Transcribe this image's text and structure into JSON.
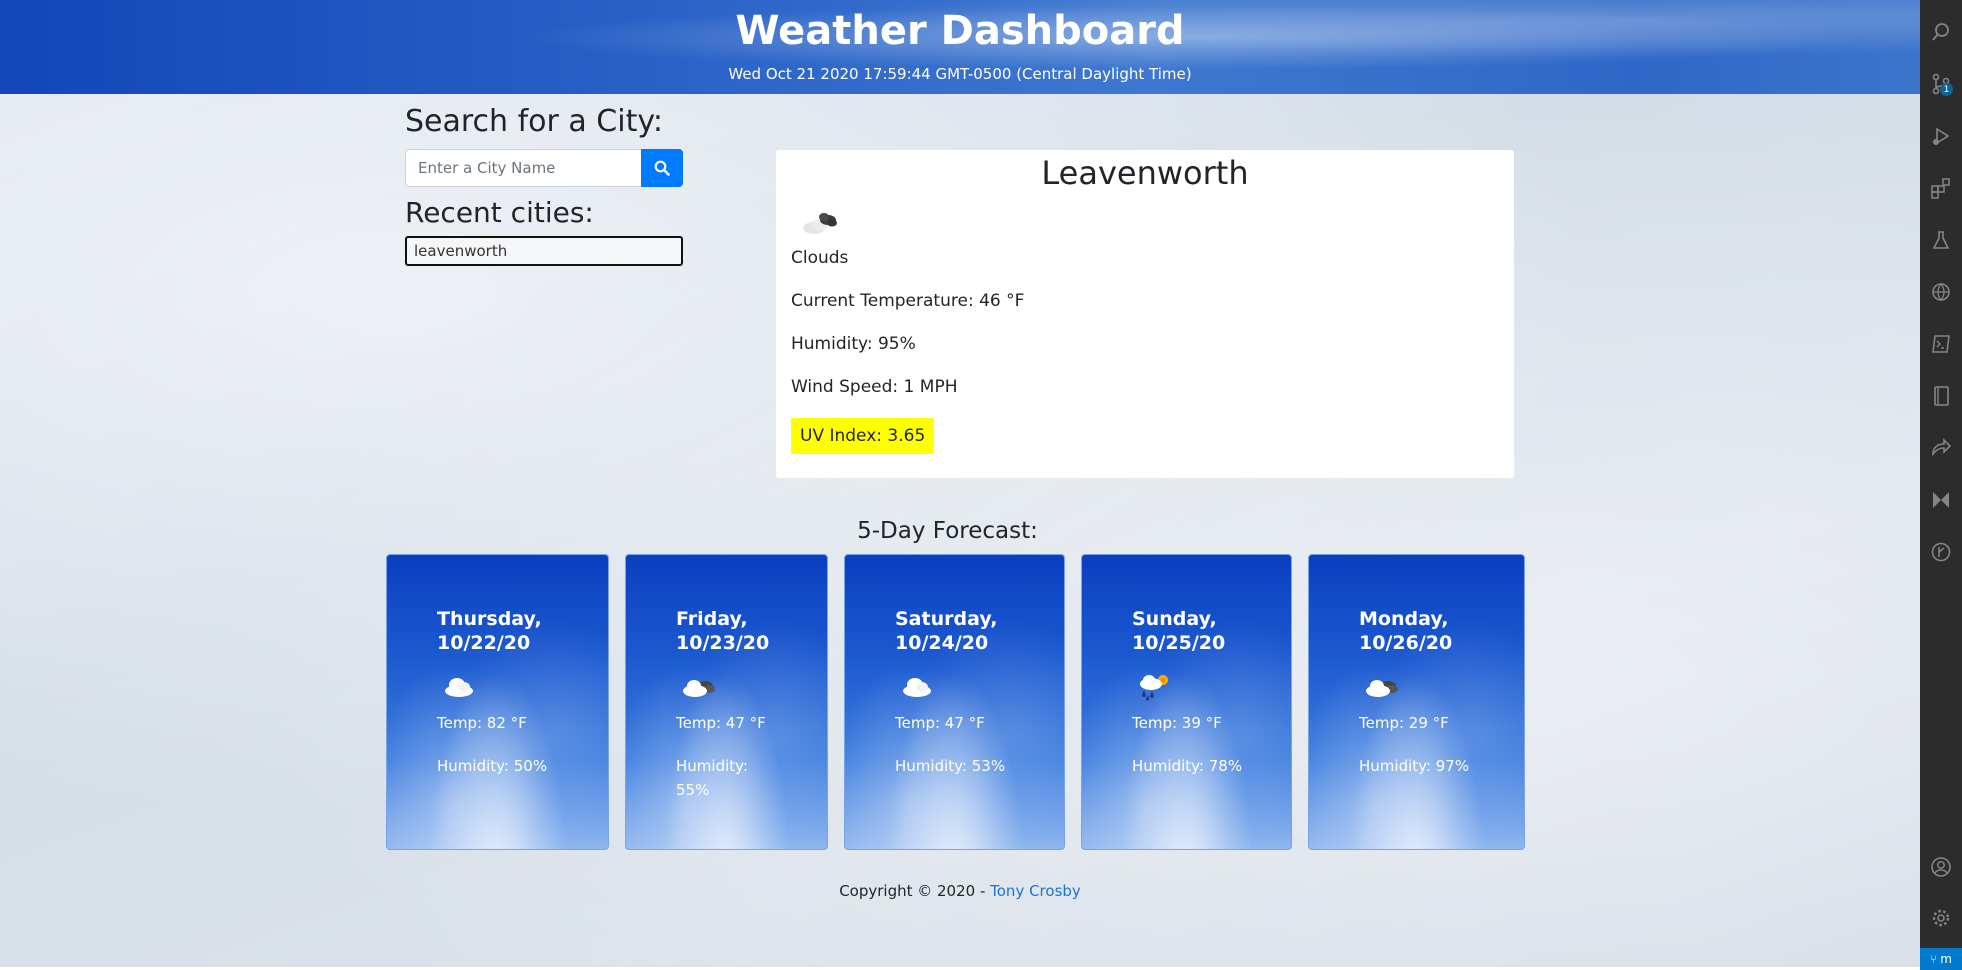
{
  "header": {
    "title": "Weather Dashboard",
    "datetime": "Wed Oct 21 2020 17:59:44 GMT-0500 (Central Daylight Time)"
  },
  "search": {
    "title": "Search for a City:",
    "placeholder": "Enter a City Name",
    "value": "",
    "button_icon": "search-icon"
  },
  "recent": {
    "title": "Recent cities:",
    "items": [
      "leavenworth"
    ]
  },
  "current": {
    "city": "Leavenworth",
    "icon": "clouds-icon",
    "condition": "Clouds",
    "temperature": "Current Temperature: 46 °F",
    "humidity": "Humidity: 95%",
    "wind": "Wind Speed: 1 MPH",
    "uv": "UV Index: 3.65",
    "uv_color": "#ffff00"
  },
  "forecast": {
    "title": "5-Day Forecast:",
    "days": [
      {
        "day": "Thursday,",
        "date": "10/22/20",
        "icon": "cloud-icon",
        "temp": "Temp: 82 °F",
        "humidity": "Humidity: 50%"
      },
      {
        "day": "Friday,",
        "date": "10/23/20",
        "icon": "broken-clouds-icon",
        "temp": "Temp: 47 °F",
        "humidity": "Humidity: 55%"
      },
      {
        "day": "Saturday,",
        "date": "10/24/20",
        "icon": "cloud-icon",
        "temp": "Temp: 47 °F",
        "humidity": "Humidity: 53%"
      },
      {
        "day": "Sunday,",
        "date": "10/25/20",
        "icon": "rain-sun-icon",
        "temp": "Temp: 39 °F",
        "humidity": "Humidity: 78%"
      },
      {
        "day": "Monday,",
        "date": "10/26/20",
        "icon": "broken-clouds-icon",
        "temp": "Temp: 29 °F",
        "humidity": "Humidity: 97%"
      }
    ]
  },
  "footer": {
    "text": "Copyright © 2020 - ",
    "author": "Tony Crosby"
  },
  "activity_bar": {
    "icons": [
      "search-icon",
      "source-control-icon",
      "run-debug-icon",
      "extensions-icon",
      "testing-icon",
      "remote-explorer-icon",
      "terminal-icon",
      "book-icon",
      "live-share-icon",
      "kite-icon",
      "git-graph-icon",
      "account-icon",
      "settings-gear-icon"
    ],
    "source_control_badge": "1",
    "status_text": "m"
  },
  "colors": {
    "accent": "#007bff",
    "header_blue": "#1346b8",
    "link": "#1a73d9"
  }
}
